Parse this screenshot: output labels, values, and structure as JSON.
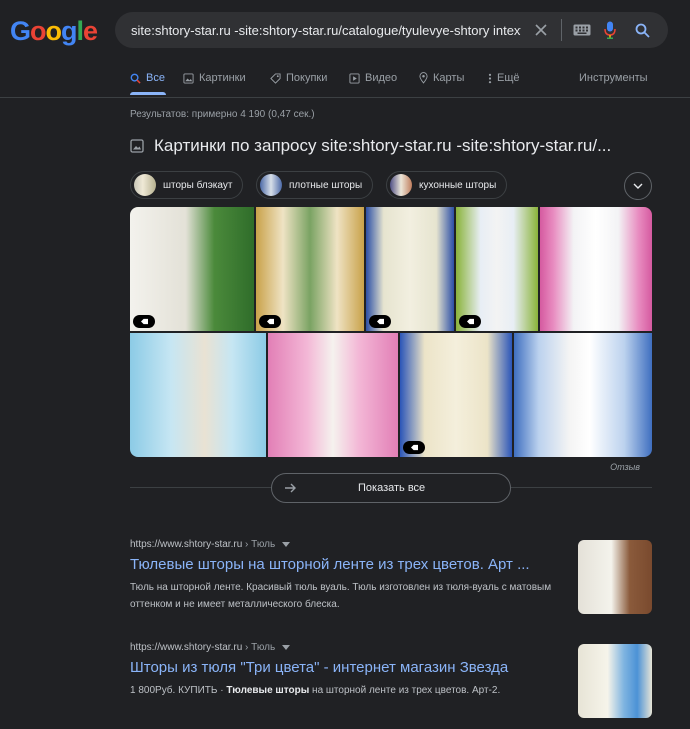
{
  "logo": {
    "letters": [
      "G",
      "o",
      "o",
      "g",
      "l",
      "e"
    ],
    "colors": [
      "#4285f4",
      "#ea4335",
      "#fbbc05",
      "#4285f4",
      "#34a853",
      "#ea4335"
    ]
  },
  "search": {
    "query": "site:shtory-star.ru -site:shtory-star.ru/catalogue/tyulevye-shtory intext:,,"
  },
  "tabs": [
    {
      "label": "Все",
      "icon": "search-icon",
      "active": true
    },
    {
      "label": "Картинки",
      "icon": "image-icon"
    },
    {
      "label": "Покупки",
      "icon": "tag-icon"
    },
    {
      "label": "Видео",
      "icon": "play-icon"
    },
    {
      "label": "Карты",
      "icon": "map-pin-icon"
    },
    {
      "label": "Ещё",
      "icon": "more-vert-icon"
    }
  ],
  "tools_label": "Инструменты",
  "stats": "Результатов: примерно 4 190 (0,47 сек.)",
  "images_section": {
    "title": "Картинки по запросу site:shtory-star.ru -site:shtory-star.ru/...",
    "chips": [
      "шторы блэкаут",
      "плотные шторы",
      "кухонные шторы"
    ],
    "feedback": "Отзыв",
    "show_all": "Показать все"
  },
  "results": [
    {
      "url": "https://www.shtory-star.ru",
      "breadcrumb": "› Тюль",
      "title": "Тюлевые шторы на шторной ленте из трех цветов. Арт ...",
      "snippet": "Тюль на шторной ленте. Красивый тюль вуаль. Тюль изготовлен из тюля-вуаль с матовым оттенком и не имеет металлического блеска."
    },
    {
      "url": "https://www.shtory-star.ru",
      "breadcrumb": "› Тюль",
      "title": "Шторы из тюля \"Три цвета\" - интернет магазин Звезда",
      "snippet_pre": "1 800Руб. КУПИТЬ · ",
      "snippet_bold": "Тюлевые шторы",
      "snippet_post": " на шторной ленте из трех цветов. Арт-2."
    }
  ],
  "colors": {
    "background": "#202124",
    "link": "#8ab4f8",
    "accent": "#8ab4f8",
    "text": "#bdc1c6",
    "muted": "#9aa0a6"
  }
}
